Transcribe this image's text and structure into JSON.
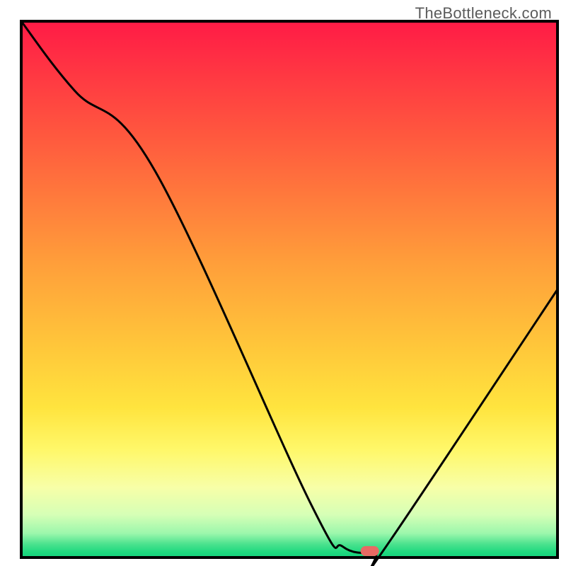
{
  "watermark": "TheBottleneck.com",
  "chart_data": {
    "type": "line",
    "title": "",
    "xlabel": "",
    "ylabel": "",
    "xlim": [
      0,
      100
    ],
    "ylim": [
      0,
      100
    ],
    "grid": false,
    "legend": false,
    "series": [
      {
        "name": "curve",
        "x": [
          0,
          10,
          25,
          54,
          60,
          66,
          68,
          100
        ],
        "y": [
          100,
          87,
          72,
          10,
          2,
          1,
          2,
          50
        ]
      }
    ],
    "marker": {
      "x": 65,
      "y": 1.2,
      "color": "#e86a64"
    },
    "background_gradient": {
      "stops": [
        {
          "offset": 0.0,
          "color": "#ff1b46"
        },
        {
          "offset": 0.22,
          "color": "#ff5a3e"
        },
        {
          "offset": 0.45,
          "color": "#ff9e3a"
        },
        {
          "offset": 0.6,
          "color": "#ffc53a"
        },
        {
          "offset": 0.72,
          "color": "#ffe43e"
        },
        {
          "offset": 0.8,
          "color": "#fff86a"
        },
        {
          "offset": 0.87,
          "color": "#f7ffa8"
        },
        {
          "offset": 0.92,
          "color": "#d6ffb6"
        },
        {
          "offset": 0.955,
          "color": "#9cf7ac"
        },
        {
          "offset": 0.975,
          "color": "#4be28e"
        },
        {
          "offset": 0.99,
          "color": "#1fd97f"
        },
        {
          "offset": 1.0,
          "color": "#15d27c"
        }
      ]
    },
    "frame_color": "#000000"
  }
}
